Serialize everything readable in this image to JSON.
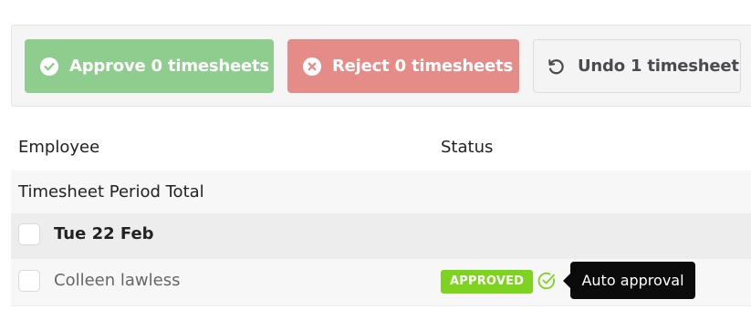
{
  "toolbar": {
    "approve_label": "Approve 0 timesheets",
    "reject_label": "Reject 0 timesheets",
    "undo_label": "Undo 1 timesheet"
  },
  "table": {
    "columns": [
      "Employee",
      "Status"
    ],
    "period_total_label": "Timesheet Period Total",
    "date_group_label": "Tue 22 Feb",
    "rows": [
      {
        "employee": "Colleen lawless",
        "status": "APPROVED",
        "tooltip": "Auto approval"
      }
    ]
  },
  "colors": {
    "approve": "#8fcd8e",
    "reject": "#e58c89",
    "status_approved": "#7ed320",
    "auto_approval_icon": "#7ed320"
  },
  "icons": {
    "approve": "check-circle-icon",
    "reject": "x-circle-icon",
    "undo": "undo-icon",
    "auto_approval": "check-circle-outline-icon"
  }
}
